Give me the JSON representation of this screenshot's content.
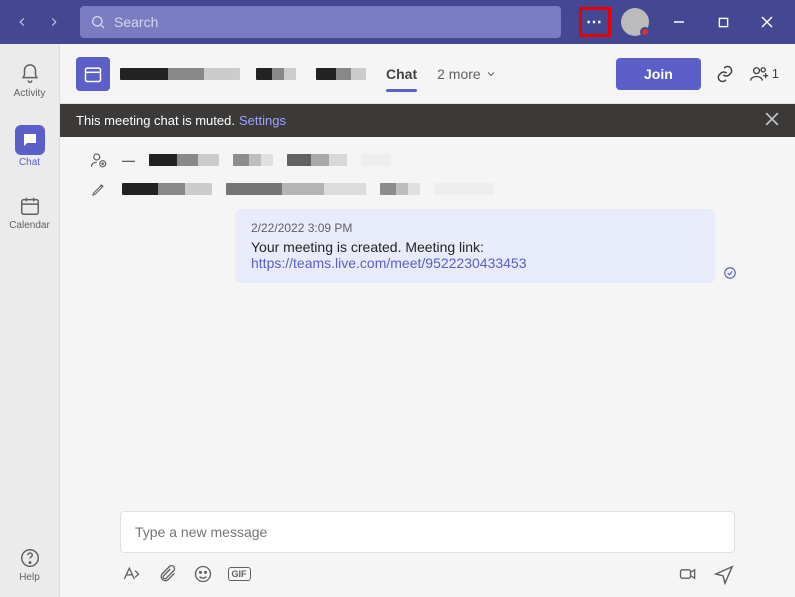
{
  "titlebar": {
    "search_placeholder": "Search"
  },
  "rail": {
    "activity": "Activity",
    "chat": "Chat",
    "calendar": "Calendar",
    "help": "Help"
  },
  "header": {
    "chat_tab": "Chat",
    "more_tabs": "2 more",
    "join": "Join",
    "people_count": "1"
  },
  "banner": {
    "text": "This meeting chat is muted.",
    "link": "Settings"
  },
  "message": {
    "timestamp": "2/22/2022 3:09 PM",
    "body": "Your meeting is created. Meeting link:",
    "link": "https://teams.live.com/meet/9522230433453"
  },
  "composer": {
    "placeholder": "Type a new message",
    "gif": "GIF"
  }
}
